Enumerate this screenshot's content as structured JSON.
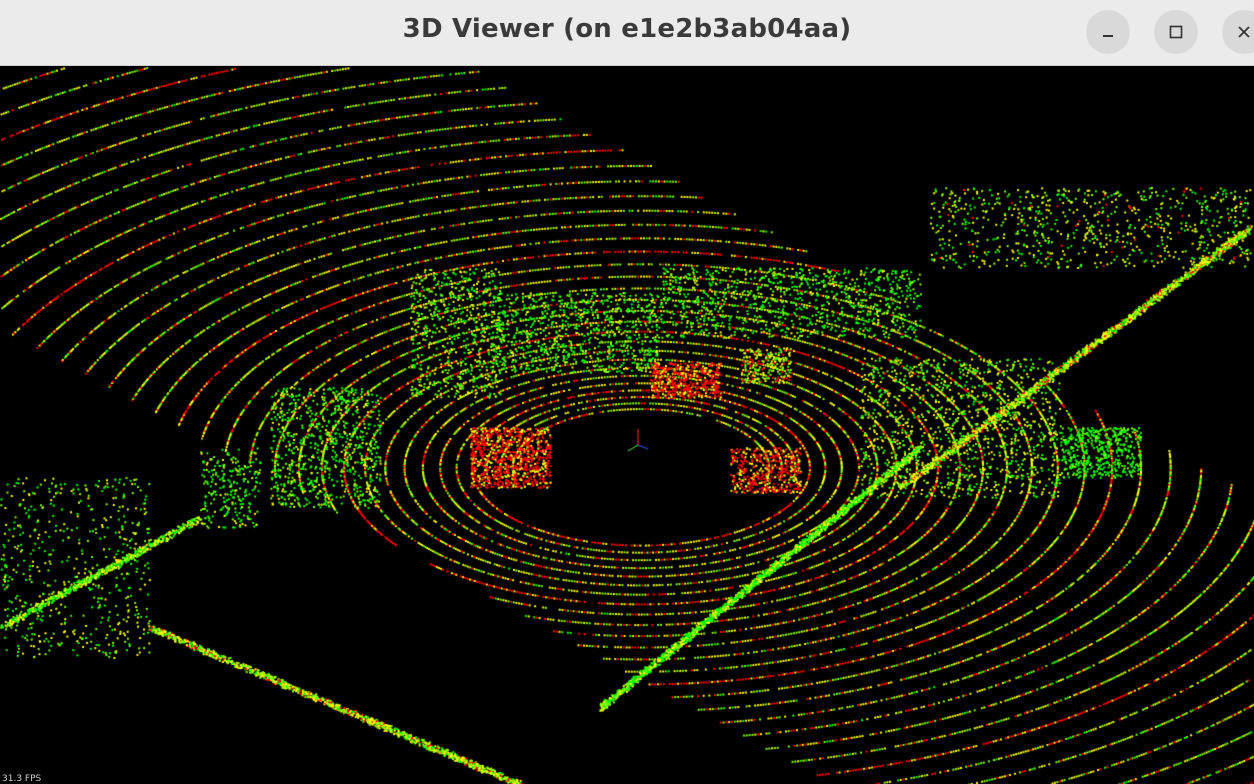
{
  "window": {
    "title": "3D Viewer (on e1e2b3ab04aa)",
    "buttons": {
      "minimize": "minimize-icon",
      "maximize": "maximize-icon",
      "close": "close-icon"
    }
  },
  "viewer": {
    "background": "#000000",
    "fps_text": "31.3 FPS",
    "point_colors": [
      "#ff0000",
      "#ffff00",
      "#80ff00",
      "#00ff00",
      "#00c8ff",
      "#0040ff"
    ]
  }
}
